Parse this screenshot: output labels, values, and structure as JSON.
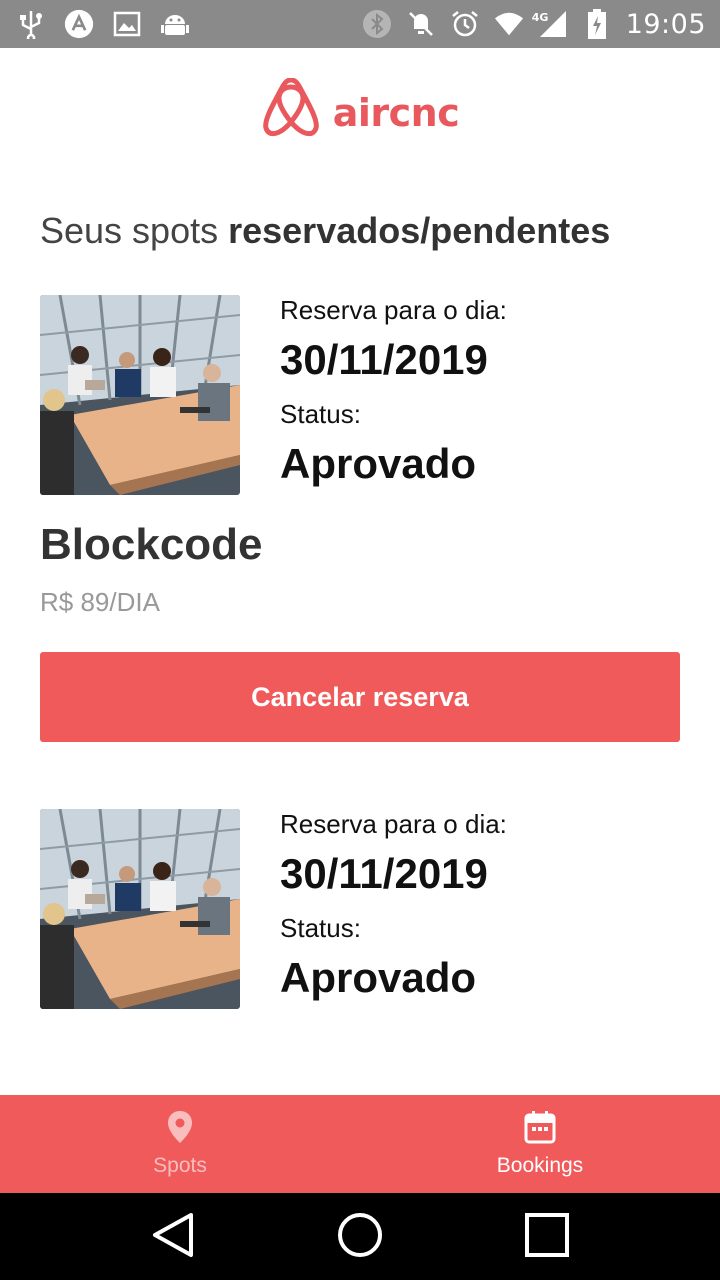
{
  "status_bar": {
    "time": "19:05",
    "network": "4G",
    "icons_left": [
      "usb-icon",
      "app-icon",
      "image-icon",
      "android-icon"
    ],
    "icons_right": [
      "bluetooth-icon",
      "mute-icon",
      "alarm-icon",
      "wifi-icon",
      "signal-icon",
      "battery-icon"
    ]
  },
  "header": {
    "logo_text": "aircnc",
    "brand_color": "#e8585d"
  },
  "page": {
    "title_regular": "Seus spots ",
    "title_bold": "reservados/pendentes"
  },
  "bookings": [
    {
      "date_label": "Reserva para o dia:",
      "date": "30/11/2019",
      "status_label": "Status:",
      "status": "Aprovado",
      "spot_name": "Blockcode",
      "price": "R$ 89/DIA",
      "cancel_label": "Cancelar reserva"
    },
    {
      "date_label": "Reserva para o dia:",
      "date": "30/11/2019",
      "status_label": "Status:",
      "status": "Aprovado"
    }
  ],
  "tabs": [
    {
      "label": "Spots",
      "icon": "map-pin-icon",
      "active": false
    },
    {
      "label": "Bookings",
      "icon": "calendar-icon",
      "active": true
    }
  ],
  "colors": {
    "accent": "#f05a5b",
    "status_bar": "#8a8a8a",
    "price_text": "#999999"
  }
}
